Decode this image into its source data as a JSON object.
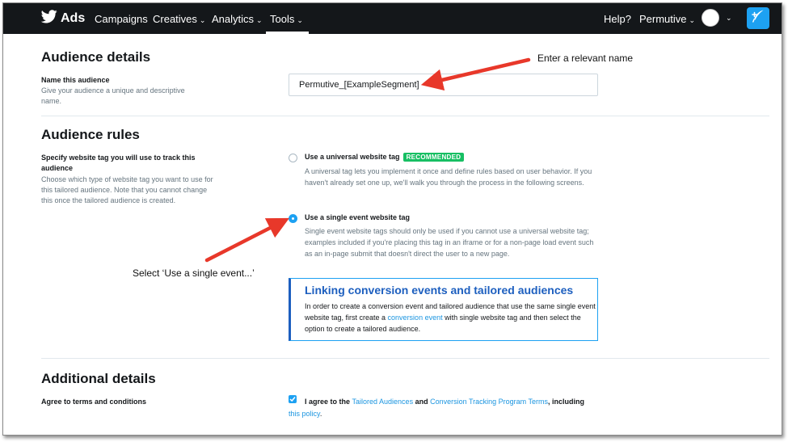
{
  "nav": {
    "brand": "Ads",
    "items": [
      {
        "label": "Campaigns",
        "chevron": false
      },
      {
        "label": "Creatives",
        "chevron": true
      },
      {
        "label": "Analytics",
        "chevron": true
      },
      {
        "label": "Tools",
        "chevron": true
      }
    ],
    "active_item": "Tools",
    "help": "Help?",
    "account": "Permutive",
    "chevron_glyph": "⌄"
  },
  "audience_details": {
    "heading": "Audience details",
    "name_label": "Name this audience",
    "name_help": "Give your audience a unique and descriptive name.",
    "name_value": "Permutive_[ExampleSegment]"
  },
  "audience_rules": {
    "heading": "Audience rules",
    "tag_label": "Specify website tag you will use to track this audience",
    "tag_help": "Choose which type of website tag you want to use for this tailored audience. Note that you cannot change this once the tailored audience is created.",
    "options": [
      {
        "title": "Use a universal website tag",
        "badge": "RECOMMENDED",
        "desc": "A universal tag lets you implement it once and define rules based on user behavior. If you haven't already set one up, we'll walk you through the process in the following screens.",
        "selected": false
      },
      {
        "title": "Use a single event website tag",
        "badge": "",
        "desc": "Single event website tags should only be used if you cannot use a universal website tag; examples included if you're placing this tag in an iframe or for a non-page load event such as an in-page submit that doesn't direct the user to a new page.",
        "selected": true
      }
    ],
    "info": {
      "title": "Linking conversion events and tailored audiences",
      "text_before": "In order to create a conversion event and tailored audience that use the same single event website tag, first create a ",
      "link": "conversion event",
      "text_after": " with single website tag and then select the option to create a tailored audience."
    }
  },
  "additional_details": {
    "heading": "Additional details",
    "terms_label": "Agree to terms and conditions",
    "agree_prefix": "I agree to the ",
    "link_tailored": "Tailored Audiences",
    "agree_and": " and ",
    "link_conversion": "Conversion Tracking Program Terms",
    "agree_including": ", including ",
    "link_policy": "this policy",
    "agree_end": ".",
    "checked": true
  },
  "annotations": {
    "name_note": "Enter a relevant name",
    "select_note": "Select ‘Use a single event...’"
  },
  "colors": {
    "nav_bg": "#14171a",
    "accent": "#1da1f2",
    "link": "#1b95e0",
    "badge": "#17bf63",
    "info_title": "#1d5fbf",
    "arrow": "#e8382a"
  }
}
